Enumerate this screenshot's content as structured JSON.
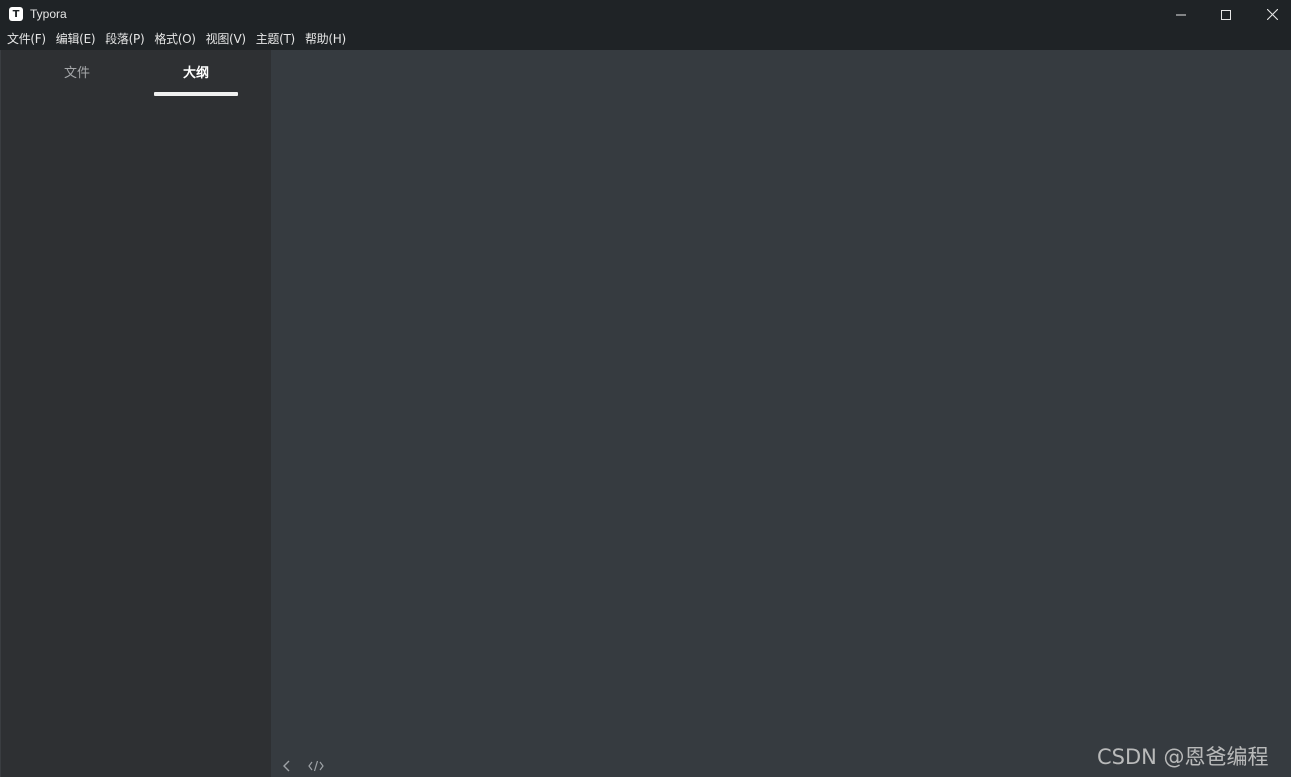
{
  "window": {
    "title": "Typora",
    "icon_letter": "T",
    "controls": [
      "minimize-icon",
      "maximize-icon",
      "close-icon"
    ]
  },
  "menu": {
    "items": [
      {
        "label": "文件(F)"
      },
      {
        "label": "编辑(E)"
      },
      {
        "label": "段落(P)"
      },
      {
        "label": "格式(O)"
      },
      {
        "label": "视图(V)"
      },
      {
        "label": "主题(T)"
      },
      {
        "label": "帮助(H)"
      }
    ]
  },
  "sidebar": {
    "tabs": [
      {
        "label": "文件",
        "active": false
      },
      {
        "label": "大纲",
        "active": true
      }
    ]
  },
  "footer": {
    "icons": [
      "chevron-left-icon",
      "source-code-icon"
    ]
  },
  "watermark": {
    "text": "CSDN @恩爸编程"
  },
  "colors": {
    "titlebar": "#1f2326",
    "sidebar": "#2e3033",
    "editor": "#363b40",
    "active_tab_text": "#ffffff",
    "inactive_tab_text": "#a5a7aa"
  }
}
